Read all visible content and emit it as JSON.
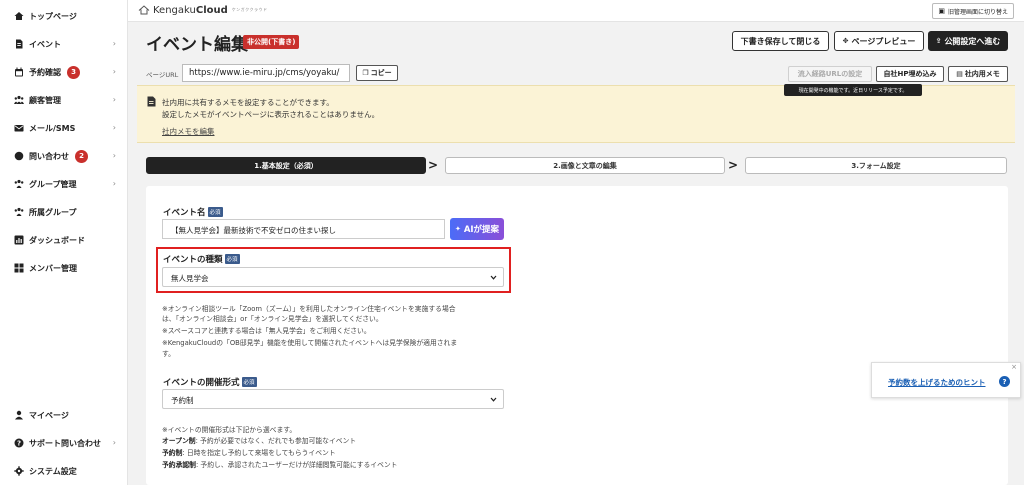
{
  "sidebar": {
    "items": [
      {
        "label": "トップページ",
        "icon": "home-icon",
        "chevron": ""
      },
      {
        "label": "イベント",
        "icon": "document-icon",
        "chevron": "›"
      },
      {
        "label": "予約確認",
        "icon": "calendar-icon",
        "badge": "3",
        "chevron": "›"
      },
      {
        "label": "顧客管理",
        "icon": "people-icon",
        "chevron": "›"
      },
      {
        "label": "メール/SMS",
        "icon": "mail-icon",
        "chevron": "›"
      },
      {
        "label": "問い合わせ",
        "icon": "chat-icon",
        "badge": "2",
        "chevron": "›"
      },
      {
        "label": "グループ管理",
        "icon": "group-icon",
        "chevron": "›"
      },
      {
        "label": "所属グループ",
        "icon": "org-icon",
        "chevron": ""
      },
      {
        "label": "ダッシュボード",
        "icon": "chart-icon",
        "chevron": ""
      },
      {
        "label": "メンバー管理",
        "icon": "grid-icon",
        "chevron": ""
      }
    ],
    "bottom_items": [
      {
        "label": "マイページ",
        "icon": "user-icon",
        "chevron": ""
      },
      {
        "label": "サポート問い合わせ",
        "icon": "help-icon",
        "chevron": "›"
      },
      {
        "label": "システム設定",
        "icon": "gear-icon",
        "chevron": ""
      }
    ]
  },
  "topbar": {
    "logo_prefix": "Kengaku",
    "logo_bold": "Cloud",
    "logo_sub": "ケンガククラウド",
    "old_admin_label": "旧管理画面に切り替え"
  },
  "header": {
    "title": "イベント編集",
    "status_badge": "非公開(下書き)",
    "save_close_label": "下書き保存して閉じる",
    "preview_label": "ページプレビュー",
    "publish_label": "公開設定へ進む"
  },
  "url_row": {
    "label": "ページURL",
    "value": "https://www.ie-miru.jp/cms/yoyaku/",
    "copy_label": "コピー",
    "inflow_label": "流入経路URLの設定",
    "embed_label": "自社HP埋め込み",
    "memo_label": "社内用メモ",
    "tooltip": "現在開発中の機能です。近日リリース予定です。"
  },
  "memo": {
    "line1": "社内用に共有するメモを設定することができます。",
    "line2": "設定したメモがイベントページに表示されることはありません。",
    "edit_link": "社内メモを編集"
  },
  "steps": [
    {
      "label": "1.基本設定（必須）"
    },
    {
      "label": "2.画像と文章の編集"
    },
    {
      "label": "3.フォーム設定"
    }
  ],
  "form": {
    "required_tag": "必須",
    "event_name": {
      "label": "イベント名",
      "value": "【無人見学会】最新技術で不安ゼロの住まい探し",
      "ai_button": "AIが提案"
    },
    "event_type": {
      "label": "イベントの種類",
      "selected": "無人見学会",
      "notes": [
        "※オンライン相談ツール「Zoom（ズーム）」を利用したオンライン住宅イベントを実施する場合",
        "は、「オンライン相談会」or「オンライン見学会」を選択してください。",
        "※スペースコアと連携する場合は「無人見学会」をご利用ください。",
        "※KengakuCloudの「OB邸見学」機能を使用して開催されたイベントへは見学保険が適用されま",
        "す。"
      ]
    },
    "event_format": {
      "label": "イベントの開催形式",
      "selected": "予約制",
      "note_intro": "※イベントの開催形式は下記から選べます。",
      "options": [
        {
          "name": "オープン制",
          "desc": ": 予約が必要ではなく、だれでも参加可能なイベント"
        },
        {
          "name": "予約制",
          "desc": ": 日時を指定し予約して来場をしてもらうイベント"
        },
        {
          "name": "予約承認制",
          "desc": ": 予約し、承認されたユーザーだけが詳細閲覧可能にするイベント"
        }
      ]
    }
  },
  "hint": {
    "text": "予約数を上げるためのヒント",
    "icon_char": "?",
    "close": "×"
  },
  "colors": {
    "badge_red": "#c9302c",
    "highlight_red": "#e02020",
    "memo_bg": "#fbf3d6",
    "required_blue": "#3b5b8c",
    "link_blue": "#1a5fb4",
    "ai_gradient_start": "#4b6cf7",
    "ai_gradient_end": "#8a4fd8"
  }
}
